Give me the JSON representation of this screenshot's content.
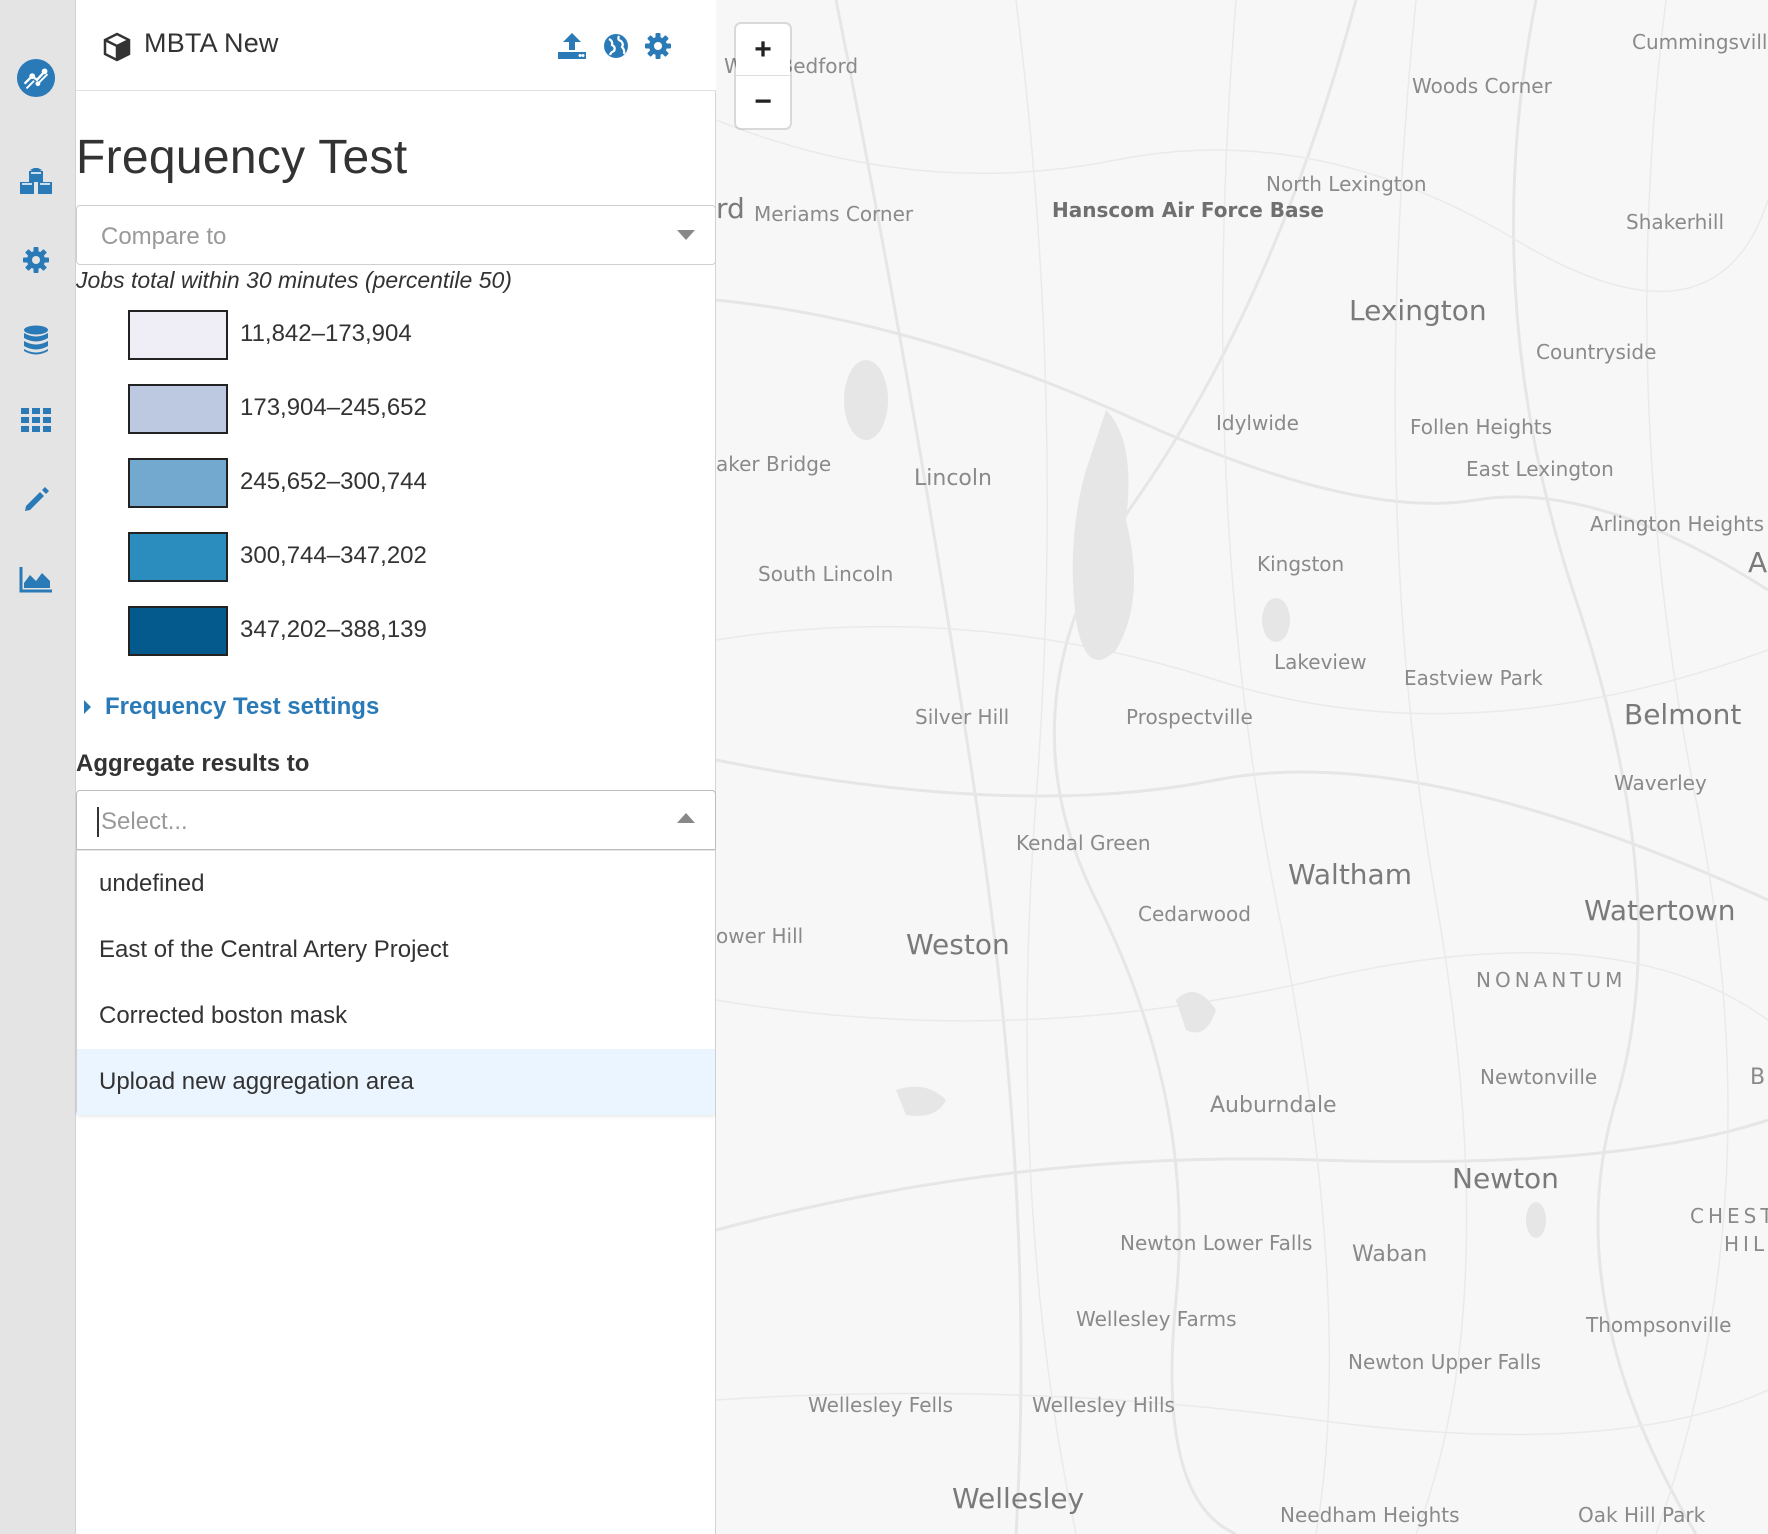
{
  "project": {
    "name": "MBTA New"
  },
  "analysis": {
    "title": "Frequency Test",
    "compare_placeholder": "Compare to",
    "legend_title": "Jobs total within 30 minutes (percentile 50)",
    "legend": [
      {
        "label": "11,842–173,904",
        "color": "#efedf5"
      },
      {
        "label": "173,904–245,652",
        "color": "#bdc9e1"
      },
      {
        "label": "245,652–300,744",
        "color": "#74a9cf"
      },
      {
        "label": "300,744–347,202",
        "color": "#2b8cbe"
      },
      {
        "label": "347,202–388,139",
        "color": "#045a8d"
      }
    ],
    "settings_label": "Frequency Test settings",
    "aggregate_label": "Aggregate results to",
    "aggregate_placeholder": "Select...",
    "aggregate_options": [
      "undefined",
      "East of the Central Artery Project",
      "Corrected boston mask",
      "Upload new aggregation area"
    ]
  },
  "colors": {
    "accent": "#2a7ab8",
    "rail_background": "#e4e4e4",
    "option_highlight": "#ebf5ff"
  },
  "icons": {
    "rail": [
      "logo-icon",
      "cubes-icon",
      "gear-icon",
      "database-icon",
      "grid-icon",
      "pencil-icon",
      "area-chart-icon"
    ],
    "header": [
      "cube-icon",
      "upload-icon",
      "globe-icon",
      "gear-icon"
    ]
  },
  "map": {
    "zoom_in": "+",
    "zoom_out": "−",
    "places": [
      "West Bedford",
      "Cummingsvill",
      "Woods Corner",
      "North Lexington",
      "Shakerhill",
      "rd",
      "Meriams Corner",
      "Hanscom Air Force Base",
      "Lexington",
      "Countryside",
      "Idylwide",
      "Follen Heights",
      "East Lexington",
      "aker Bridge",
      "Lincoln",
      "Arlington Heights",
      "A",
      "South Lincoln",
      "Kingston",
      "Lakeview",
      "Eastview Park",
      "Silver Hill",
      "Prospectville",
      "Belmont",
      "Waverley",
      "Kendal Green",
      "Waltham",
      "Cedarwood",
      "Watertown",
      "ower Hill",
      "Weston",
      "NONANTUM",
      "Newtonville",
      "B",
      "Auburndale",
      "Newton",
      "CHEST",
      "HIL",
      "Newton Lower Falls",
      "Waban",
      "Wellesley Farms",
      "Thompsonville",
      "Newton Upper Falls",
      "Wellesley Fells",
      "Wellesley Hills",
      "Wellesley",
      "Needham Heights",
      "Oak Hill Park"
    ]
  }
}
